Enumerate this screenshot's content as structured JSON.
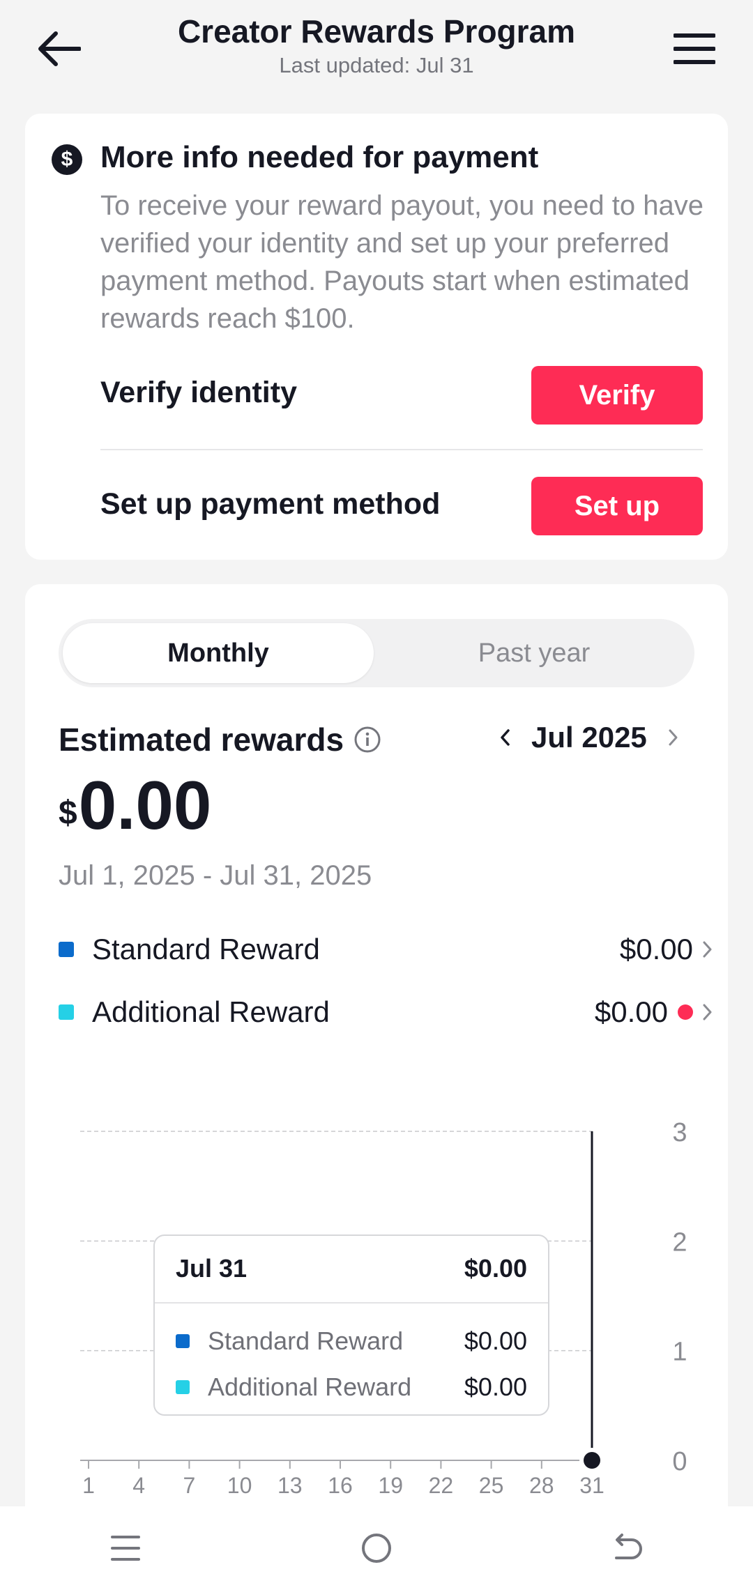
{
  "header": {
    "title": "Creator Rewards Program",
    "subtitle": "Last updated: Jul 31"
  },
  "payment_card": {
    "badge": "$",
    "title": "More info needed for payment",
    "description": "To receive your reward payout, you need to have verified your identity and set up your preferred payment method. Payouts start when estimated rewards reach $100.",
    "verify_label": "Verify identity",
    "verify_button": "Verify",
    "setup_label": "Set up payment method",
    "setup_button": "Set up"
  },
  "rewards": {
    "tabs": [
      "Monthly",
      "Past year"
    ],
    "selected_tab": "Monthly",
    "title": "Estimated rewards",
    "month": "Jul 2025",
    "currency": "$",
    "amount": "0.00",
    "date_range": "Jul 1, 2025 - Jul 31, 2025",
    "legend": [
      {
        "label": "Standard Reward",
        "value": "$0.00",
        "color": "#0b6bcb"
      },
      {
        "label": "Additional Reward",
        "value": "$0.00",
        "color": "#25d0e6"
      }
    ]
  },
  "chart_data": {
    "type": "line",
    "x": [
      "1",
      "4",
      "7",
      "10",
      "13",
      "16",
      "19",
      "22",
      "25",
      "28",
      "31"
    ],
    "series": [
      {
        "name": "Standard Reward",
        "values": [
          0,
          0,
          0,
          0,
          0,
          0,
          0,
          0,
          0,
          0,
          0
        ]
      },
      {
        "name": "Additional Reward",
        "values": [
          0,
          0,
          0,
          0,
          0,
          0,
          0,
          0,
          0,
          0,
          0
        ]
      }
    ],
    "y_ticks": [
      "0",
      "1",
      "2",
      "3"
    ],
    "ylim": [
      0,
      3
    ],
    "selected_x": "31",
    "grid": true,
    "tooltip": {
      "date": "Jul 31",
      "total": "$0.00",
      "rows": [
        {
          "label": "Standard Reward",
          "value": "$0.00"
        },
        {
          "label": "Additional Reward",
          "value": "$0.00"
        }
      ]
    }
  },
  "colors": {
    "accent": "#fe2c55",
    "standard": "#0b6bcb",
    "additional": "#25d0e6"
  },
  "icons": {
    "back": "arrow-left-icon",
    "menu": "hamburger-icon",
    "info": "info-circle-icon",
    "nav": [
      "recents-icon",
      "home-icon",
      "back-icon"
    ]
  }
}
